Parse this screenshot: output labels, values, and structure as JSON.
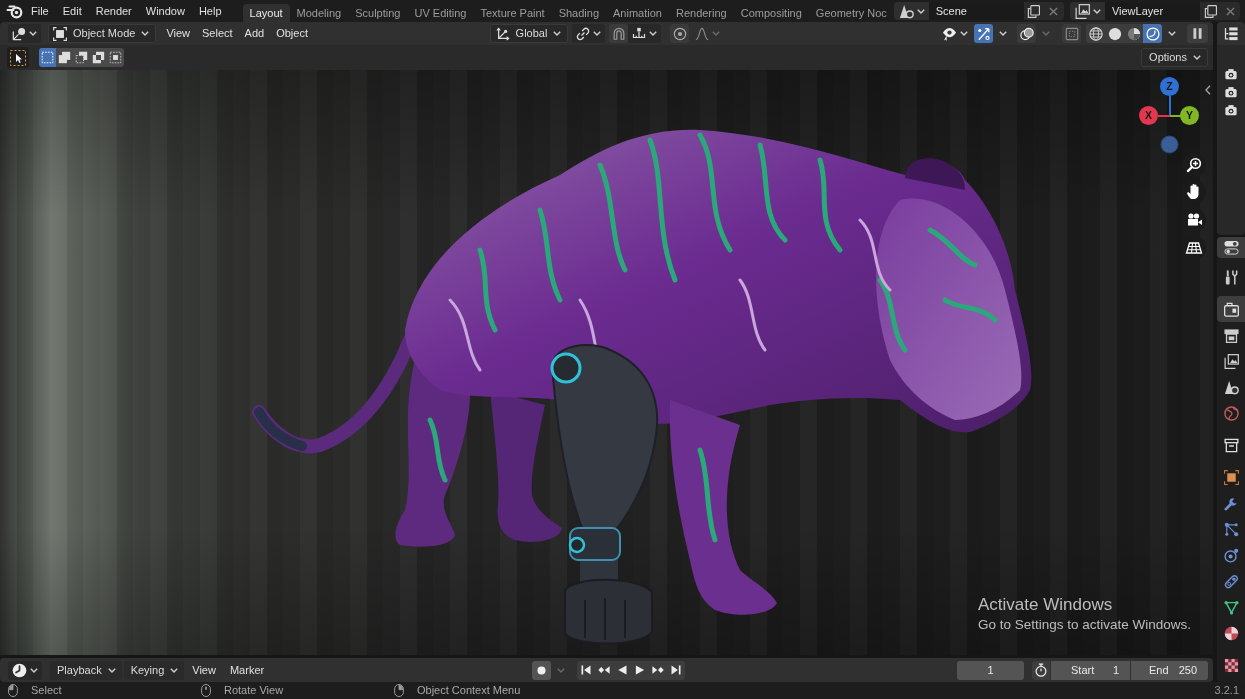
{
  "top_bar": {
    "menus": [
      "File",
      "Edit",
      "Render",
      "Window",
      "Help"
    ],
    "workspace_tabs": [
      {
        "label": "Layout",
        "selected": true
      },
      {
        "label": "Modeling",
        "selected": false
      },
      {
        "label": "Sculpting",
        "selected": false
      },
      {
        "label": "UV Editing",
        "selected": false
      },
      {
        "label": "Texture Paint",
        "selected": false
      },
      {
        "label": "Shading",
        "selected": false
      },
      {
        "label": "Animation",
        "selected": false
      },
      {
        "label": "Rendering",
        "selected": false
      },
      {
        "label": "Compositing",
        "selected": false
      },
      {
        "label": "Geometry Noc",
        "selected": false
      }
    ],
    "scene_field": "Scene",
    "view_layer_field": "ViewLayer"
  },
  "viewport_header": {
    "mode_dropdown": "Object Mode",
    "menus": [
      "View",
      "Select",
      "Add",
      "Object"
    ],
    "orientation_dropdown": "Global",
    "snap_toggle": {
      "on": false
    },
    "proportional_toggle": {
      "on": false
    },
    "gizmo_toggle": {
      "on": true
    },
    "overlay_toggle": {
      "on": false
    },
    "xray_toggle": {
      "on": false
    },
    "shading_modes": [
      {
        "kind": "wireframe",
        "selected": false
      },
      {
        "kind": "solid",
        "selected": false
      },
      {
        "kind": "material",
        "selected": false
      },
      {
        "kind": "rendered",
        "selected": true
      }
    ]
  },
  "tool_settings": {
    "select_modes": [
      {
        "kind": "set",
        "selected": true
      },
      {
        "kind": "extend",
        "selected": false
      },
      {
        "kind": "subtract",
        "selected": false
      },
      {
        "kind": "invert",
        "selected": false
      },
      {
        "kind": "intersect",
        "selected": false
      }
    ],
    "options_dropdown": "Options"
  },
  "viewport": {
    "axis_gizmo": [
      {
        "label": "Z",
        "color": "#2e70d4"
      },
      {
        "label": "X",
        "color": "#e3374f"
      },
      {
        "label": "Y",
        "color": "#80b722"
      }
    ],
    "system_notice": {
      "title": "Activate Windows",
      "text": "Go to Settings to activate Windows."
    }
  },
  "properties_tabs": [
    {
      "tabs": [
        {
          "kind": "tool",
          "selected": false
        }
      ]
    },
    {
      "tabs": [
        {
          "kind": "render",
          "selected": true
        },
        {
          "kind": "output",
          "selected": false
        },
        {
          "kind": "view_layer",
          "selected": false
        },
        {
          "kind": "scene",
          "selected": false
        },
        {
          "kind": "world",
          "selected": false
        }
      ]
    },
    {
      "tabs": [
        {
          "kind": "collection",
          "selected": false
        }
      ]
    },
    {
      "tabs": [
        {
          "kind": "object",
          "selected": false
        },
        {
          "kind": "modifiers",
          "selected": false
        },
        {
          "kind": "particles",
          "selected": false
        },
        {
          "kind": "physics",
          "selected": false
        },
        {
          "kind": "constraints",
          "selected": false
        },
        {
          "kind": "data",
          "selected": false
        },
        {
          "kind": "material",
          "selected": false
        }
      ]
    },
    {
      "tabs": [
        {
          "kind": "texture",
          "selected": false
        }
      ]
    }
  ],
  "timeline_header": {
    "menus": [
      {
        "label": "Playback",
        "kind": "dropdown"
      },
      {
        "label": "Keying",
        "kind": "dropdown"
      },
      {
        "label": "View",
        "kind": "menu"
      },
      {
        "label": "Marker",
        "kind": "menu"
      }
    ],
    "record_toggle": {
      "on": false
    },
    "current_frame": "1",
    "start_label": "Start",
    "start_frame": "1",
    "end_label": "End",
    "end_frame": "250"
  },
  "status_bar": {
    "hints": [
      {
        "kind": "left",
        "label": "Select"
      },
      {
        "kind": "middle",
        "label": "Rotate View"
      },
      {
        "kind": "right",
        "label": "Object Context Menu"
      }
    ],
    "version": "3.2.1"
  }
}
